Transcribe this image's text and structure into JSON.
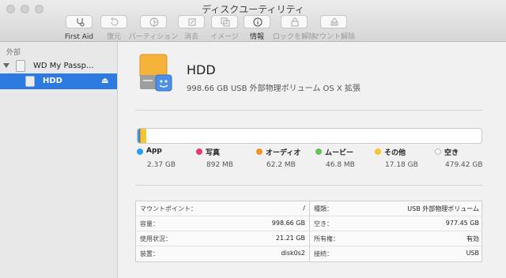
{
  "window": {
    "title": "ディスクユーティリティ"
  },
  "toolbar": [
    {
      "label": "First Aid",
      "icon": "stethoscope-icon",
      "enabled": true
    },
    {
      "label": "復元",
      "icon": "restore-icon",
      "enabled": false
    },
    {
      "label": "パーティション",
      "icon": "partition-icon",
      "enabled": false
    },
    {
      "label": "消去",
      "icon": "erase-icon",
      "enabled": false
    },
    {
      "label": "イメージ",
      "icon": "image-icon",
      "enabled": false
    },
    {
      "label": "情報",
      "icon": "info-icon",
      "enabled": true
    },
    {
      "label": "ロックを解除",
      "icon": "lock-icon",
      "enabled": false
    },
    {
      "label": "マウント解除",
      "icon": "unmount-icon",
      "enabled": false
    }
  ],
  "sidebar": {
    "section": "外部",
    "drive": "WD My Passp...",
    "volume": "HDD",
    "eject_symbol": "⏏"
  },
  "volume": {
    "name": "HDD",
    "description": "998.66 GB USB 外部物理ボリューム OS X 拡張"
  },
  "usage": {
    "total_gb": 998.66,
    "segments": [
      {
        "name": "App",
        "size": "2.37 GB",
        "gb": 2.37,
        "color": "#2a9df4"
      },
      {
        "name": "写真",
        "size": "892 MB",
        "gb": 0.892,
        "color": "#e8396c"
      },
      {
        "name": "オーディオ",
        "size": "62.2 MB",
        "gb": 0.0622,
        "color": "#f5942a"
      },
      {
        "name": "ムービー",
        "size": "46.8 MB",
        "gb": 0.0468,
        "color": "#62c554"
      },
      {
        "name": "その他",
        "size": "17.18 GB",
        "gb": 17.18,
        "color": "#f6c631"
      },
      {
        "name": "空き",
        "size": "479.42 GB",
        "gb": 479.42,
        "color": "#ffffff"
      }
    ]
  },
  "info": {
    "left": [
      {
        "key": "マウントポイント：",
        "value": "/"
      },
      {
        "key": "容量：",
        "value": "998.66 GB"
      },
      {
        "key": "使用状況：",
        "value": "21.21 GB"
      },
      {
        "key": "装置：",
        "value": "disk0s2"
      }
    ],
    "right": [
      {
        "key": "種類：",
        "value": "USB 外部物理ボリューム"
      },
      {
        "key": "空き：",
        "value": "977.45 GB"
      },
      {
        "key": "所有権：",
        "value": "有効"
      },
      {
        "key": "接続：",
        "value": "USB"
      }
    ]
  }
}
